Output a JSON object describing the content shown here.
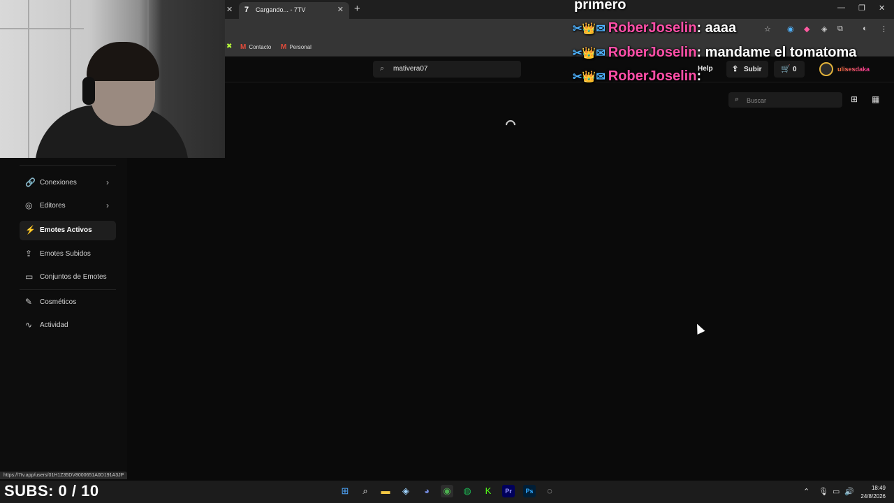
{
  "browser": {
    "tab_title": "Cargando... - 7TV",
    "bookmarks": [
      "Contacto",
      "Personal"
    ],
    "status_url": "https://7tv.app/users/01H1Z35DV8000651A0D191A3JP"
  },
  "chat": {
    "first_line": "primero",
    "messages": [
      {
        "user": "RoberJoselin",
        "text": ": aaaa"
      },
      {
        "user": "RoberJoselin",
        "text": ": mandame el tomatoma"
      },
      {
        "user": "RoberJoselin",
        "text": ":"
      }
    ]
  },
  "header": {
    "search_value": "mativera07",
    "help": "Help",
    "upload": "Subir",
    "cart_count": "0",
    "username": "ulisesdaka"
  },
  "sidebar": {
    "items": [
      {
        "label": "Conexiones",
        "icon": "link-icon",
        "chevron": true
      },
      {
        "label": "Editores",
        "icon": "user-circle-icon",
        "chevron": true
      },
      {
        "label": "Emotes Activos",
        "icon": "bolt-icon",
        "active": true
      },
      {
        "label": "Emotes Subidos",
        "icon": "upload-icon"
      },
      {
        "label": "Conjuntos de Emotes",
        "icon": "folder-icon"
      },
      {
        "label": "Cosméticos",
        "icon": "brush-icon"
      },
      {
        "label": "Actividad",
        "icon": "activity-icon"
      }
    ]
  },
  "content": {
    "search_placeholder": "Buscar"
  },
  "overlay": {
    "subs": "SUBS: 0 / 10"
  },
  "taskbar": {
    "time": "18:49",
    "date": "24/8/2026"
  }
}
